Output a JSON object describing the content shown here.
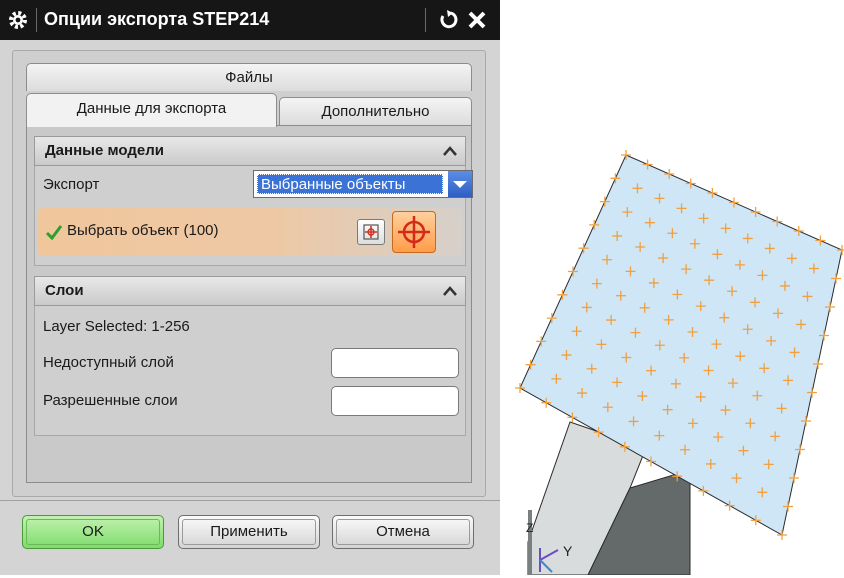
{
  "title": "Опции экспорта STEP214",
  "tabs": {
    "files": "Файлы",
    "export_data": "Данные для экспорта",
    "extra": "Дополнительно"
  },
  "model_section": {
    "title": "Данные модели",
    "export_label": "Экспорт",
    "export_value": "Выбранные объекты",
    "select_label": "Выбрать объект (100)"
  },
  "layers_section": {
    "title": "Слои",
    "layer_selected": "Layer Selected: 1-256",
    "unavailable_label": "Недоступный слой",
    "unavailable_value": "",
    "allowed_label": "Разрешенные слои",
    "allowed_value": ""
  },
  "buttons": {
    "ok": "OK",
    "apply": "Применить",
    "cancel": "Отмена"
  },
  "viewport": {
    "axis_y": "Y",
    "axis_z": "Z"
  },
  "colors": {
    "accent": "#3a72d6",
    "ok_button": "#7fdc6c",
    "select_highlight": "#ff9c4a",
    "surface": "#cfe6f6",
    "point_marker": "#f0a040"
  }
}
